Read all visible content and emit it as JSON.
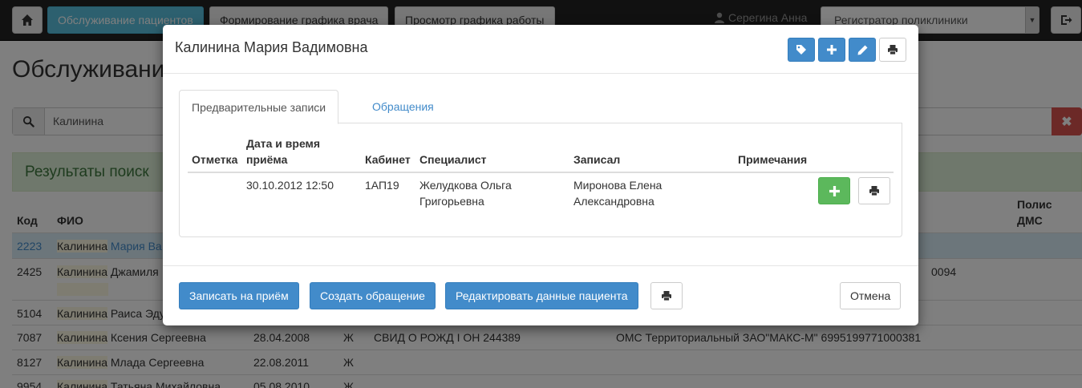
{
  "navbar": {
    "nav_tabs": [
      {
        "label": "Обслуживание пациентов"
      },
      {
        "label": "Формирование графика врача"
      },
      {
        "label": "Просмотр графика работы"
      }
    ],
    "user_name": "Серегина Анна",
    "role_select_value": "Регистратор поликлиники"
  },
  "page": {
    "title": "Обслуживани",
    "search_value": "Калинина",
    "results_title": "Результаты поиск",
    "table_headers": {
      "code": "Код",
      "fio": "ФИО",
      "polis_dms_1": "Полис",
      "polis_dms_2": "ДМС"
    },
    "rows": [
      {
        "code": "2223",
        "surname": "Калинина",
        "rest": "Мария Ва",
        "date": "",
        "sex": "",
        "doc": "",
        "polis": ""
      },
      {
        "code": "2425",
        "surname": "Калинина",
        "rest": "Джамиля",
        "date": "",
        "sex": "",
        "doc": "",
        "polis": "0094"
      },
      {
        "code": "5104",
        "surname": "Калинина",
        "rest": "Раиса Эду",
        "date": "",
        "sex": "",
        "doc": "",
        "polis": ""
      },
      {
        "code": "7087",
        "surname": "Калинина",
        "rest": "Ксения Сергеевна",
        "date": "28.04.2008",
        "sex": "Ж",
        "doc": "СВИД О РОЖД I ОН 244389",
        "polis": "ОМС Территориальный ЗАО\"МАКС-М\" 6995199771000381"
      },
      {
        "code": "8127",
        "surname": "Калинина",
        "rest": "Млада Сергеевна",
        "date": "22.08.2011",
        "sex": "Ж",
        "doc": "",
        "polis": ""
      },
      {
        "code": "9954",
        "surname": "Калинина",
        "rest": "Татьяна Михайловна",
        "date": "05.08.2010",
        "sex": "Ж",
        "doc": "",
        "polis": ""
      }
    ]
  },
  "modal": {
    "title": "Калинина Мария Вадимовна",
    "tabs": [
      {
        "label": "Предварительные записи"
      },
      {
        "label": "Обращения"
      }
    ],
    "table": {
      "headers": {
        "mark": "Отметка",
        "datetime_1": "Дата и время",
        "datetime_2": "приёма",
        "room": "Кабинет",
        "specialist": "Специалист",
        "recorded_by": "Записал",
        "notes": "Примечания"
      },
      "rows": [
        {
          "mark": "",
          "datetime": "30.10.2012 12:50",
          "room": "1АП19",
          "specialist_1": "Желудкова Ольга",
          "specialist_2": "Григорьевна",
          "recorded_by_1": "Миронова Елена",
          "recorded_by_2": "Александровна",
          "notes": ""
        }
      ]
    },
    "footer": {
      "book_label": "Записать на приём",
      "create_label": "Создать обращение",
      "edit_label": "Редактировать данные пациента",
      "cancel_label": "Отмена"
    }
  },
  "colors": {
    "primary": "#428bca",
    "info": "#5bc0de",
    "success": "#5cb85c",
    "danger": "#d9534f",
    "navbar": "#222222"
  },
  "icons": [
    "home-icon",
    "user-icon",
    "logout-icon",
    "search-icon",
    "remove-icon",
    "tag-icon",
    "plus-icon",
    "pencil-icon",
    "print-icon"
  ]
}
